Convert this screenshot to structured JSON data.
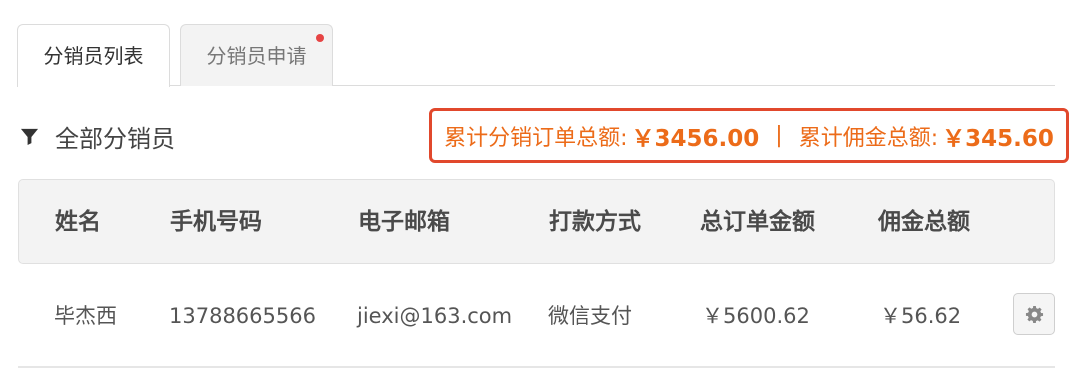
{
  "tabs": [
    {
      "label": "分销员列表",
      "active": true
    },
    {
      "label": "分销员申请",
      "active": false,
      "has_notification": true
    }
  ],
  "filter": {
    "label": "全部分销员",
    "icon": "filter-icon"
  },
  "summary": {
    "order_total_label": "累计分销订单总额:",
    "order_total_value": "￥3456.00",
    "separator": "|",
    "commission_total_label": "累计佣金总额:",
    "commission_total_value": "￥345.60",
    "text_color": "#ec6b19",
    "border_color": "#e1482c"
  },
  "table": {
    "columns": [
      "姓名",
      "手机号码",
      "电子邮箱",
      "打款方式",
      "总订单金额",
      "佣金总额"
    ],
    "rows": [
      {
        "name": "毕杰西",
        "phone": "13788665566",
        "email": "jiexi@163.com",
        "payment": "微信支付",
        "order_total": "￥5600.62",
        "commission": "￥56.62",
        "action_icon": "gear-icon"
      }
    ]
  },
  "colors": {
    "notification_dot": "#e64444"
  }
}
